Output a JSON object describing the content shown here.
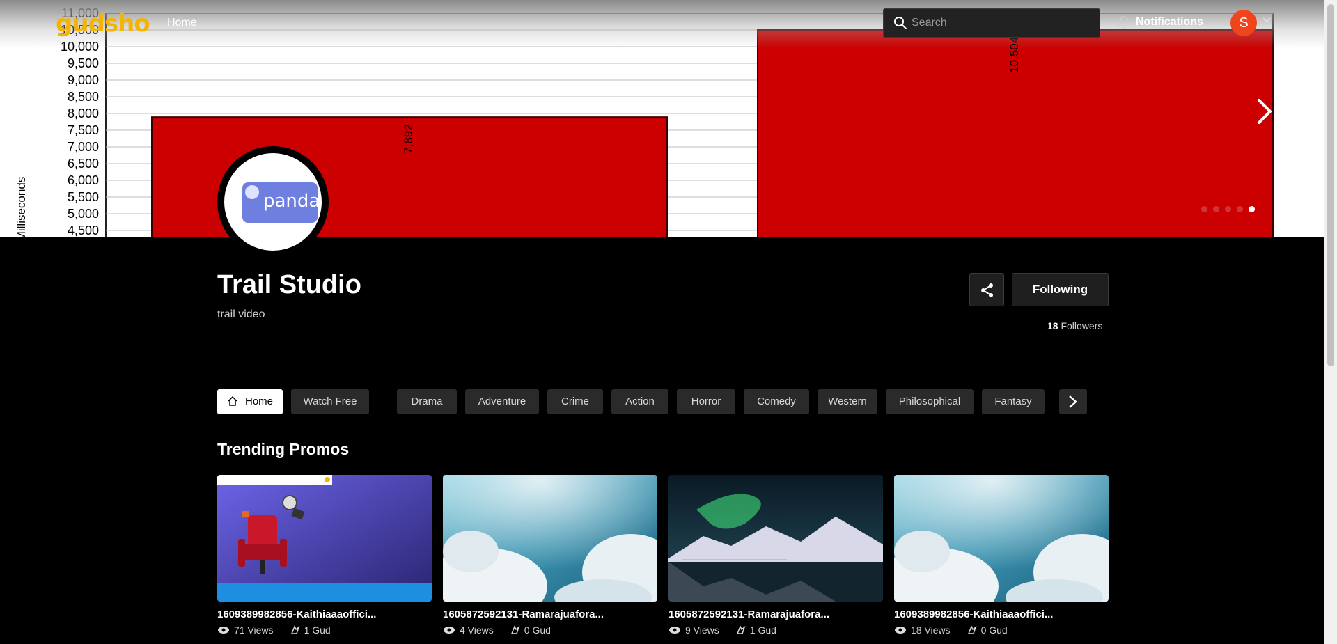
{
  "nav": {
    "logo": "gudsho",
    "home_label": "Home",
    "search_placeholder": "Search",
    "notifications_label": "Notifications",
    "avatar_initial": "S"
  },
  "banner": {
    "y_axis_label": "Milliseconds",
    "y_ticks": [
      "11,000",
      "10,500",
      "10,000",
      "9,500",
      "9,000",
      "8,500",
      "8,000",
      "7,500",
      "7,000",
      "6,500",
      "6,000",
      "5,500",
      "5,000",
      "4,500"
    ],
    "bar_labels": [
      "7,892",
      "10,504"
    ],
    "bar_values": [
      7892,
      10504
    ],
    "carousel_total": 5,
    "carousel_active": 5
  },
  "channel": {
    "title": "Trail Studio",
    "subtitle": "trail video",
    "avatar_text": "panda",
    "follow_label": "Following",
    "followers_count": "18",
    "followers_label": "Followers"
  },
  "tabs": {
    "home": "Home",
    "watch_free": "Watch Free",
    "genres": [
      "Drama",
      "Adventure",
      "Crime",
      "Action",
      "Horror",
      "Comedy",
      "Western",
      "Philosophical",
      "Fantasy"
    ]
  },
  "trending": {
    "title": "Trending Promos",
    "items": [
      {
        "title": "1609389982856-Kaithiaaaoffici...",
        "views": "71 Views",
        "guds": "1 Gud",
        "thumb": "cinema-seat"
      },
      {
        "title": "1605872592131-Ramarajuafora...",
        "views": "4 Views",
        "guds": "0 Gud",
        "thumb": "sky-clouds"
      },
      {
        "title": "1605872592131-Ramarajuafora...",
        "views": "9 Views",
        "guds": "1 Gud",
        "thumb": "aurora-mountains"
      },
      {
        "title": "1609389982856-Kaithiaaaoffici...",
        "views": "18 Views",
        "guds": "0 Gud",
        "thumb": "sky-clouds"
      }
    ]
  },
  "colors": {
    "accent_logo": "#f5b400",
    "avatar_bg": "#f0441c",
    "bar_red": "#cc0000"
  }
}
